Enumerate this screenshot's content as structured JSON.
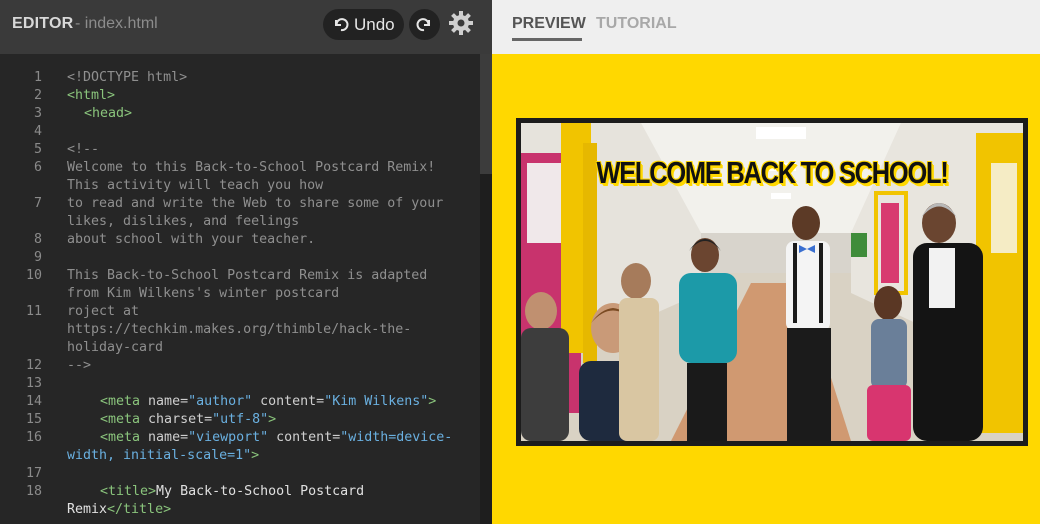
{
  "editor": {
    "title": "EDITOR",
    "file": "- index.html",
    "undo_label": "Undo"
  },
  "preview": {
    "tabs": [
      "PREVIEW",
      "TUTORIAL"
    ],
    "postcard_heading": "WELCOME BACK TO SCHOOL!"
  },
  "colors": {
    "preview_background": "#ffd800",
    "editor_background": "#262626",
    "tag_color": "#8ac47c",
    "value_color": "#6ab0e0"
  },
  "icons": [
    "undo-icon",
    "redo-icon",
    "gear-icon"
  ],
  "code": {
    "line_numbers": [
      "1",
      "2",
      "3",
      "4",
      "5",
      "6",
      "7",
      "8",
      "9",
      "10",
      "11",
      "12",
      "13",
      "14",
      "15",
      "16",
      "17",
      "18"
    ],
    "lines": {
      "l1": "<!DOCTYPE html>",
      "l2": "<html>",
      "l3": "<head>",
      "l5": "<!--",
      "l6a": "Welcome to this Back-to-School Postcard Remix!",
      "l6b": "This activity will teach you how",
      "l7a": "to read and write the Web to share some of your",
      "l7b": "likes, dislikes, and feelings",
      "l8": "about school with your teacher.",
      "l10a": "This Back-to-School Postcard Remix is adapted",
      "l10b": "from Kim Wilkens's winter postcard",
      "l11a": "roject at",
      "l11b": "https://techkim.makes.org/thimble/hack-the-",
      "l11c": "holiday-card",
      "l12": "-->",
      "l14_tag": "<meta",
      "l14_attr1": "name=",
      "l14_val1": "\"author\"",
      "l14_attr2": "content=",
      "l14_val2": "\"Kim Wilkens\"",
      "l14_end": ">",
      "l15_tag": "<meta",
      "l15_attr": "charset=",
      "l15_val": "\"utf-8\"",
      "l15_end": ">",
      "l16_tag": "<meta",
      "l16_attr1": "name=",
      "l16_val1": "\"viewport\"",
      "l16_attr2": "content=",
      "l16_val2a": "\"width=device-",
      "l16_val2b": "width, initial-scale=1\"",
      "l16_end": ">",
      "l18_open": "<title>",
      "l18_text": "My Back-to-School Postcard",
      "l18_text2": "Remix",
      "l18_close": "</title>"
    }
  }
}
